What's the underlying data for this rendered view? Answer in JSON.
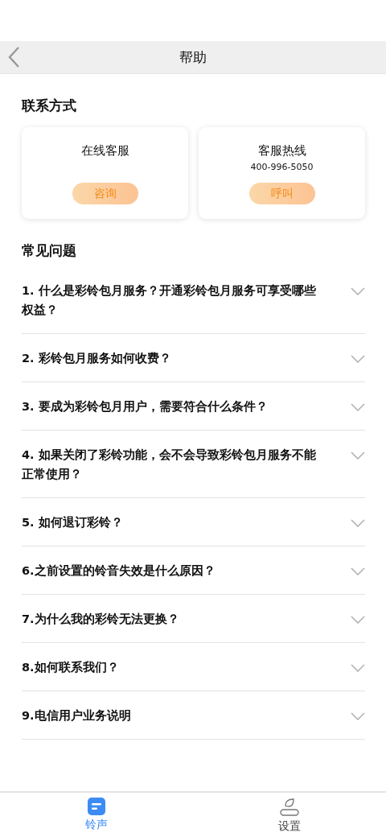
{
  "header": {
    "title": "帮助"
  },
  "contact": {
    "title": "联系方式",
    "cards": [
      {
        "title": "在线客服",
        "action": "咨询"
      },
      {
        "title": "客服热线",
        "phone": "400-996-5050",
        "action": "呼叫"
      }
    ]
  },
  "faq": {
    "title": "常见问题",
    "items": [
      {
        "question": "1. 什么是彩铃包月服务？开通彩铃包月服务可享受哪些权益？",
        "expanded": false
      },
      {
        "question": "2. 彩铃包月服务如何收费？",
        "expanded": false
      },
      {
        "question": "3. 要成为彩铃包月用户，需要符合什么条件？",
        "expanded": false
      },
      {
        "question": "4. 如果关闭了彩铃功能，会不会导致彩铃包月服务不能正常使用？",
        "expanded": false
      },
      {
        "question": "5. 如何退订彩铃？",
        "expanded": false
      },
      {
        "question": "6.之前设置的铃音失效是什么原因？",
        "expanded": false
      },
      {
        "question": "7.为什么我的彩铃无法更换？",
        "expanded": false
      },
      {
        "question": "8.如何联系我们？",
        "expanded": false
      },
      {
        "question": "9.电信用户业务说明",
        "expanded": false
      }
    ]
  },
  "tabbar": [
    {
      "kind": "ringtone",
      "label": "铃声",
      "selected": true
    },
    {
      "kind": "settings",
      "label": "设置",
      "selected": false
    }
  ]
}
